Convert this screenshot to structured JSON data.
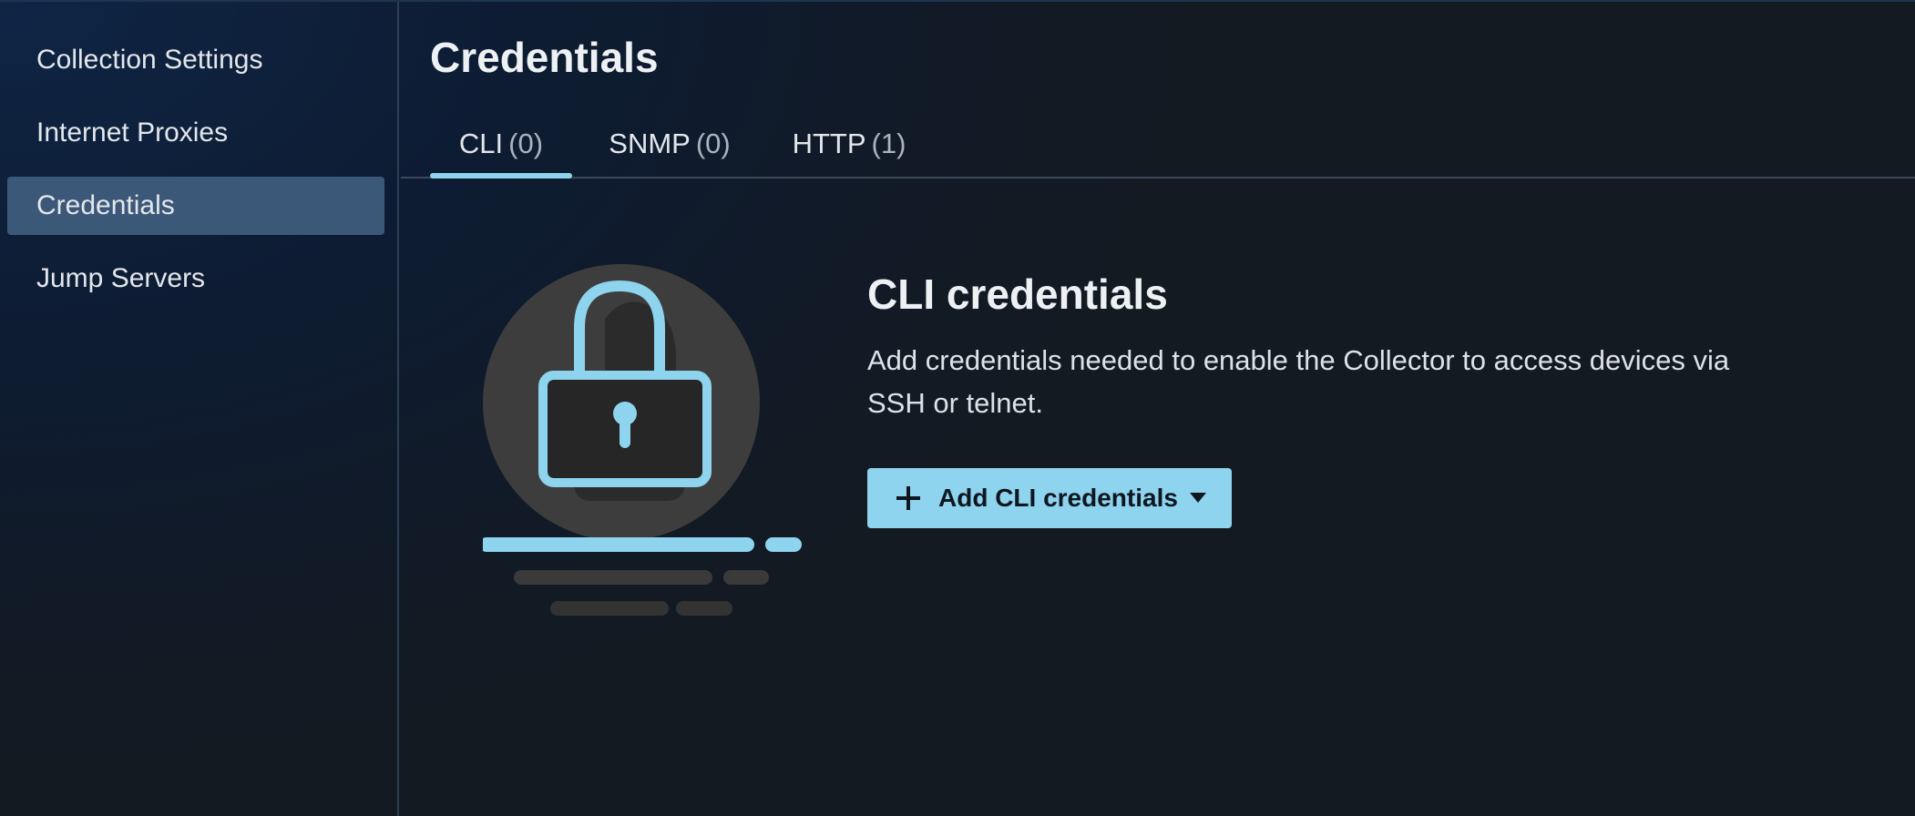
{
  "sidebar": {
    "items": [
      {
        "label": "Collection Settings",
        "active": false
      },
      {
        "label": "Internet Proxies",
        "active": false
      },
      {
        "label": "Credentials",
        "active": true
      },
      {
        "label": "Jump Servers",
        "active": false
      }
    ]
  },
  "main": {
    "title": "Credentials",
    "tabs": [
      {
        "label": "CLI",
        "count": "(0)",
        "active": true
      },
      {
        "label": "SNMP",
        "count": "(0)",
        "active": false
      },
      {
        "label": "HTTP",
        "count": "(1)",
        "active": false
      }
    ],
    "empty_state": {
      "title": "CLI credentials",
      "description": "Add credentials needed to enable the Collector to access devices via SSH or telnet.",
      "button_label": "Add CLI credentials",
      "icon": "lock-icon"
    }
  },
  "colors": {
    "accent": "#8fd4ee",
    "active_nav_bg": "#3c5878"
  }
}
